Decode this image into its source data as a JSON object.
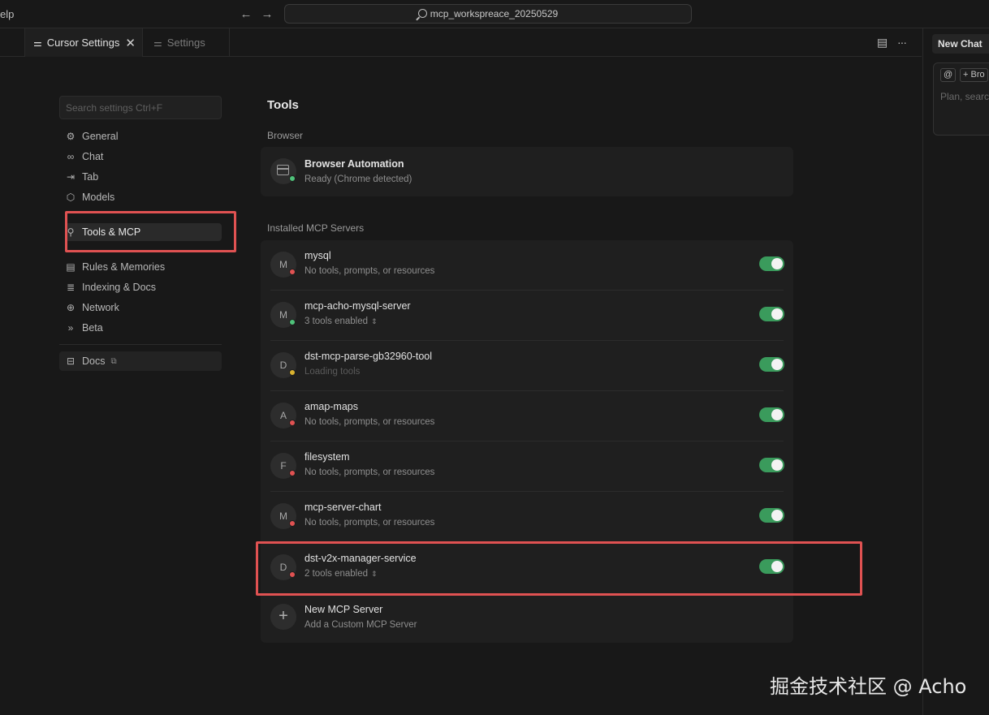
{
  "titlebar": {
    "menu_fragment": "elp",
    "back_icon": "arrow-left-icon",
    "forward_icon": "arrow-right-icon",
    "workspace": "mcp_workspreace_20250529"
  },
  "tabs": [
    {
      "label": "Cursor Settings",
      "icon": "sliders-icon",
      "active": true,
      "close": "✕"
    },
    {
      "label": "Settings",
      "icon": "sliders-icon",
      "active": false
    }
  ],
  "tab_tools": {
    "layout_icon": "split-layout-icon",
    "more_icon": "ellipsis-icon",
    "more": "···"
  },
  "chat": {
    "tab_label": "New Chat",
    "chip_at": "@",
    "chip_browser": "+ Bro",
    "placeholder": "Plan, searc"
  },
  "sidebar": {
    "search_placeholder": "Search settings Ctrl+F",
    "items": [
      {
        "label": "General",
        "icon": "gear-icon"
      },
      {
        "label": "Chat",
        "icon": "infinity-icon"
      },
      {
        "label": "Tab",
        "icon": "tab-arrow-icon"
      },
      {
        "label": "Models",
        "icon": "cube-icon"
      },
      {
        "label": "Tools & MCP",
        "icon": "tools-icon"
      },
      {
        "label": "Rules & Memories",
        "icon": "clipboard-icon"
      },
      {
        "label": "Indexing & Docs",
        "icon": "database-icon"
      },
      {
        "label": "Network",
        "icon": "globe-icon"
      },
      {
        "label": "Beta",
        "icon": "chevrons-right-icon"
      }
    ],
    "docs": {
      "label": "Docs",
      "icon": "book-icon",
      "external_icon": "external-link-icon"
    }
  },
  "main": {
    "heading": "Tools",
    "browser_section": "Browser",
    "browser": {
      "title": "Browser Automation",
      "subtitle": "Ready (Chrome detected)",
      "status_color": "#4fc27a"
    },
    "mcp_section": "Installed MCP Servers",
    "servers": [
      {
        "initial": "M",
        "name": "mysql",
        "subtitle": "No tools, prompts, or resources",
        "status_color": "#e05252",
        "enabled": true
      },
      {
        "initial": "M",
        "name": "mcp-acho-mysql-server",
        "subtitle": "3 tools enabled",
        "status_color": "#4fc27a",
        "enabled": true,
        "expandable": true
      },
      {
        "initial": "D",
        "name": "dst-mcp-parse-gb32960-tool",
        "subtitle": "Loading tools",
        "status_color": "#d9b22f",
        "enabled": true,
        "dim": true
      },
      {
        "initial": "A",
        "name": "amap-maps",
        "subtitle": "No tools, prompts, or resources",
        "status_color": "#e05252",
        "enabled": true
      },
      {
        "initial": "F",
        "name": "filesystem",
        "subtitle": "No tools, prompts, or resources",
        "status_color": "#e05252",
        "enabled": true
      },
      {
        "initial": "M",
        "name": "mcp-server-chart",
        "subtitle": "No tools, prompts, or resources",
        "status_color": "#e05252",
        "enabled": true
      },
      {
        "initial": "D",
        "name": "dst-v2x-manager-service",
        "subtitle": "2 tools enabled",
        "status_color": "#e05252",
        "enabled": true,
        "expandable": true
      }
    ],
    "new_server": {
      "title": "New MCP Server",
      "subtitle": "Add a Custom MCP Server"
    }
  },
  "chevron_glyph": "⌃⌄",
  "watermark": "掘金技术社区 @ Acho",
  "accent_colors": {
    "toggle_on": "#3a9b5c",
    "highlight": "#e05252"
  }
}
